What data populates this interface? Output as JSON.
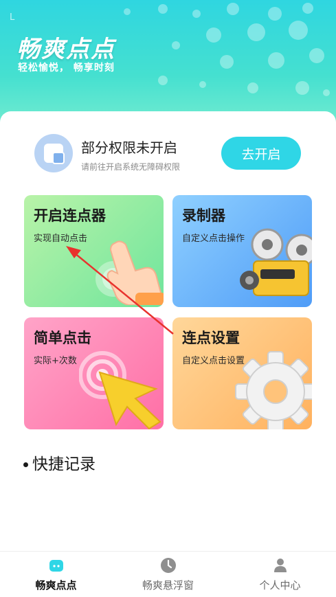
{
  "status": {
    "mark": "L"
  },
  "header": {
    "title": "畅爽点点",
    "slogan": "轻松愉悦， 畅享时刻"
  },
  "permission": {
    "title": "部分权限未开启",
    "subtitle": "请前往开启系统无障碍权限",
    "button_label": "去开启",
    "accent": "#2fd6e6"
  },
  "tiles": [
    {
      "title": "开启连点器",
      "subtitle": "实现自动点击",
      "icon": "hand-tap-icon"
    },
    {
      "title": "录制器",
      "subtitle": "自定义点击操作",
      "icon": "film-projector-icon"
    },
    {
      "title": "简单点击",
      "subtitle": "实际+次数",
      "icon": "cursor-arrow-icon"
    },
    {
      "title": "连点设置",
      "subtitle": "自定义点击设置",
      "icon": "gear-icon"
    }
  ],
  "section": {
    "title": "快捷记录"
  },
  "tabbar": {
    "items": [
      {
        "label": "畅爽点点",
        "icon": "home-icon",
        "active": true
      },
      {
        "label": "畅爽悬浮窗",
        "icon": "clock-icon",
        "active": false
      },
      {
        "label": "个人中心",
        "icon": "person-icon",
        "active": false
      }
    ]
  },
  "colors": {
    "header_top": "#2fd6e0",
    "header_bottom": "#7ceed0",
    "annotation_arrow": "#e8322d"
  }
}
